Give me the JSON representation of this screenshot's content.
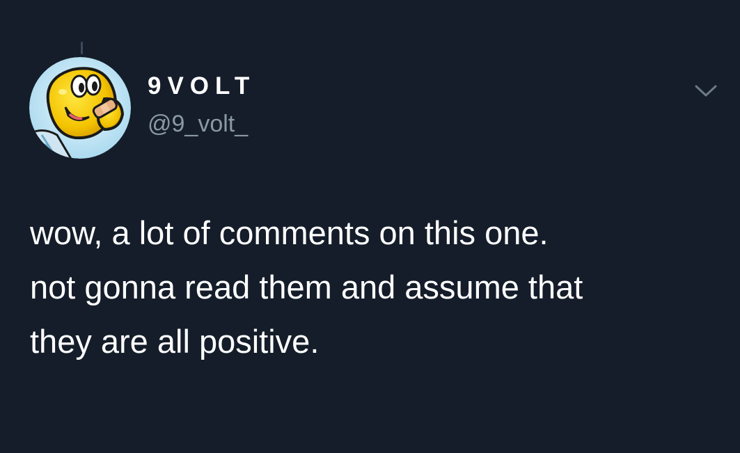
{
  "author": {
    "display_name": "9VOLT",
    "handle": "@9_volt_",
    "avatar_icon": "koopa-troopa-avatar-icon"
  },
  "menu": {
    "icon": "chevron-down-icon"
  },
  "tweet": {
    "lines": [
      "wow, a lot of comments on this one.",
      "not gonna read them and assume that",
      "they are all positive."
    ]
  },
  "colors": {
    "background": "#151d2a",
    "text_primary": "#ffffff",
    "text_secondary": "#8b98a5",
    "thread_line": "#3d4a5c"
  }
}
